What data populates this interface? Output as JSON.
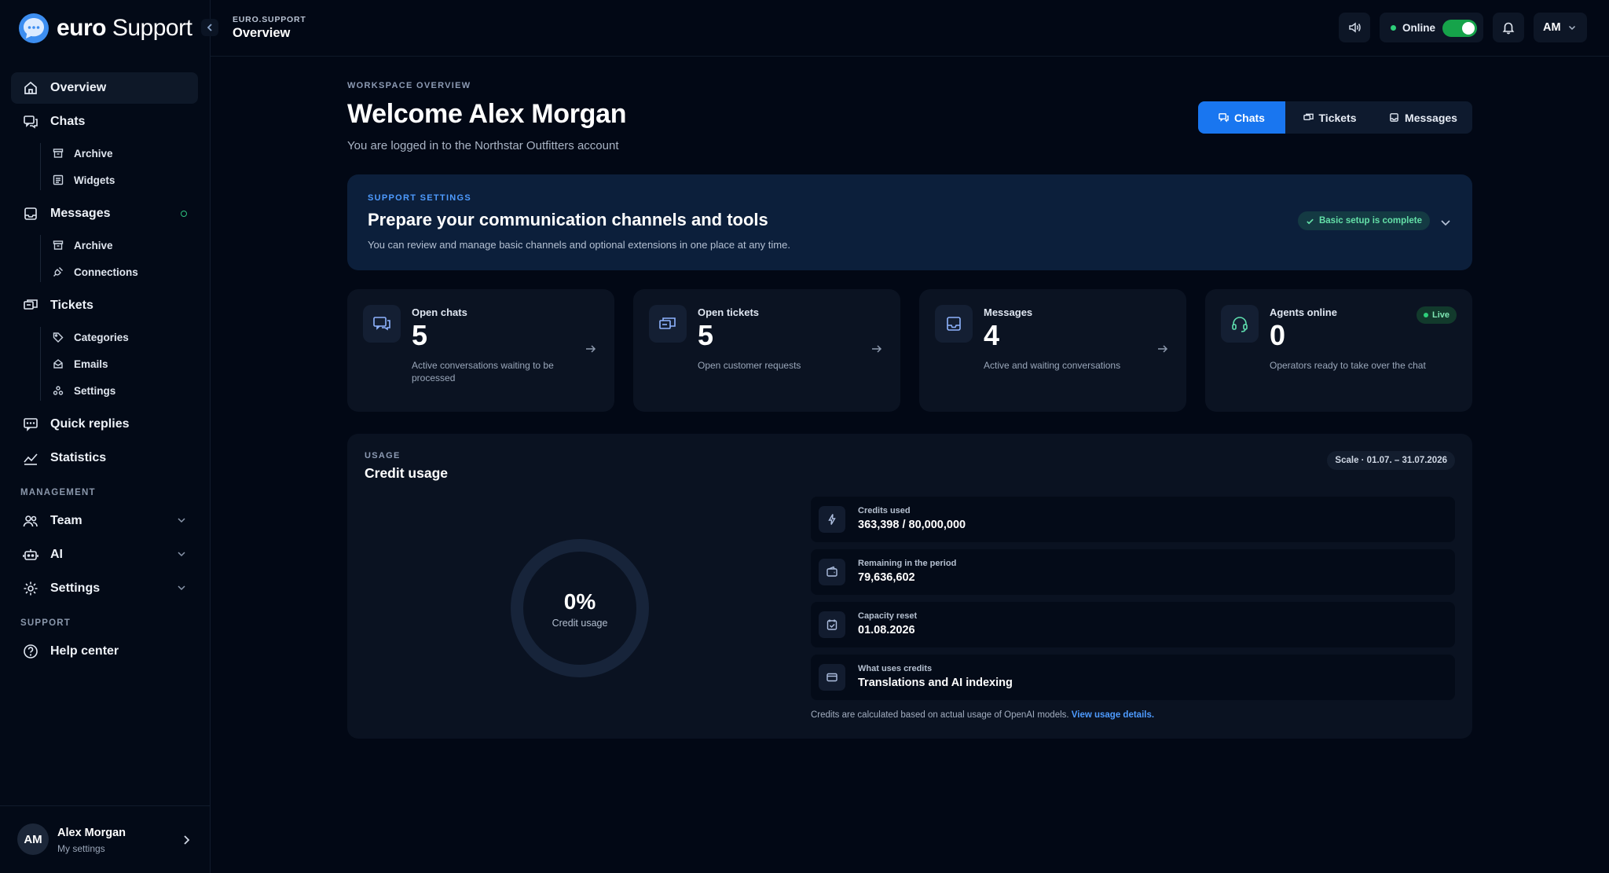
{
  "brand": {
    "name_bold": "euro",
    "name_light": " Support"
  },
  "breadcrumb": {
    "workspace": "EURO.SUPPORT",
    "page": "Overview"
  },
  "sidebar": {
    "overview": "Overview",
    "chats": {
      "label": "Chats",
      "sub": [
        "Archive",
        "Widgets"
      ]
    },
    "messages": {
      "label": "Messages",
      "sub": [
        "Archive",
        "Connections"
      ]
    },
    "tickets": {
      "label": "Tickets",
      "sub": [
        "Categories",
        "Emails",
        "Settings"
      ]
    },
    "quick_replies": "Quick replies",
    "statistics": "Statistics",
    "management_label": "MANAGEMENT",
    "team": "Team",
    "ai": "AI",
    "settings": "Settings",
    "support_label": "SUPPORT",
    "help_center": "Help center"
  },
  "user": {
    "initials": "AM",
    "name": "Alex Morgan",
    "sub": "My settings"
  },
  "topbar": {
    "status": "Online",
    "user_initials": "AM"
  },
  "header": {
    "eyebrow": "WORKSPACE OVERVIEW",
    "title": "Welcome Alex Morgan",
    "subtitle": "You are logged in to the Northstar Outfitters account",
    "tabs": [
      "Chats",
      "Tickets",
      "Messages"
    ]
  },
  "setup": {
    "eyebrow": "SUPPORT SETTINGS",
    "title": "Prepare your communication channels and tools",
    "desc": "You can review and manage basic channels and optional extensions in one place at any time.",
    "badge": "Basic setup is complete"
  },
  "stats": [
    {
      "label": "Open chats",
      "value": "5",
      "desc": "Active conversations waiting to be processed"
    },
    {
      "label": "Open tickets",
      "value": "5",
      "desc": "Open customer requests"
    },
    {
      "label": "Messages",
      "value": "4",
      "desc": "Active and waiting conversations"
    },
    {
      "label": "Agents online",
      "value": "0",
      "desc": "Operators ready to take over the chat",
      "badge": "Live"
    }
  ],
  "usage": {
    "eyebrow": "USAGE",
    "title": "Credit usage",
    "scale": "Scale · 01.07. – 31.07.2026",
    "percent": "0%",
    "percent_value": 0,
    "ring_label": "Credit usage",
    "rows": [
      {
        "label": "Credits used",
        "value": "363,398 / 80,000,000"
      },
      {
        "label": "Remaining in the period",
        "value": "79,636,602"
      },
      {
        "label": "Capacity reset",
        "value": "01.08.2026"
      },
      {
        "label": "What uses credits",
        "value": "Translations and AI indexing"
      }
    ],
    "footnote": "Credits are calculated based on actual usage of OpenAI models.",
    "footnote_link": "View usage details."
  },
  "colors": {
    "accent": "#1976f0",
    "online": "#2ecf7a",
    "setup_bg": "#0c1f3b",
    "background": "#020815"
  }
}
